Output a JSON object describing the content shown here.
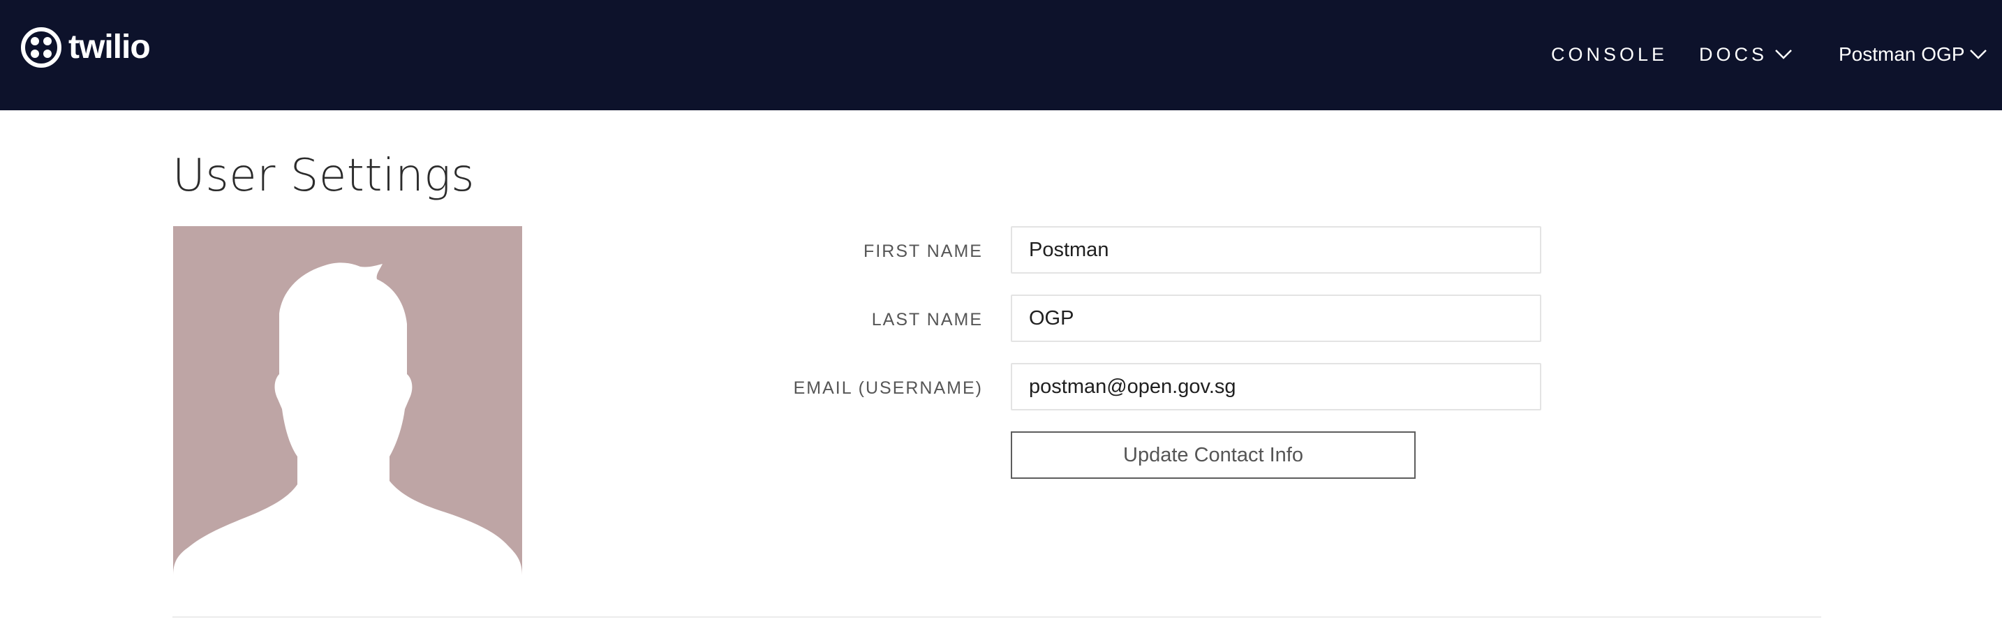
{
  "nav": {
    "logo_text": "twilio",
    "console_label": "CONSOLE",
    "docs_label": "DOCS",
    "user_label": "Postman OGP",
    "background_color": "#0d122b"
  },
  "page": {
    "title": "User Settings"
  },
  "avatar": {
    "icon": "user-silhouette-icon",
    "background_color": "#bea5a5"
  },
  "form": {
    "first_name_label": "FIRST NAME",
    "first_name_value": "Postman",
    "last_name_label": "LAST NAME",
    "last_name_value": "OGP",
    "email_label": "EMAIL (USERNAME)",
    "email_value": "postman@open.gov.sg",
    "update_button_label": "Update Contact Info"
  }
}
